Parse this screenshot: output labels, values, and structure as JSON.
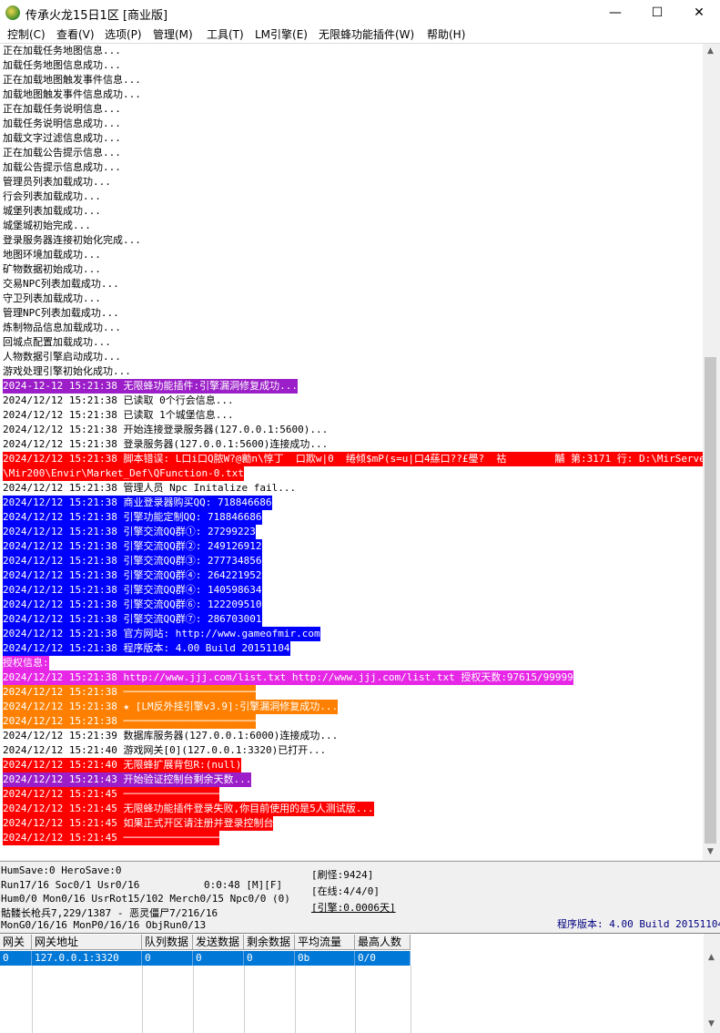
{
  "window": {
    "title": "传承火龙15日1区 [商业版]",
    "minimize": "—",
    "maximize": "☐",
    "close": "✕"
  },
  "menu": [
    "控制(C)",
    "查看(V)",
    "选项(P)",
    "管理(M)",
    "工具(T)",
    "LM引擎(E)",
    "无限蜂功能插件(W)",
    "帮助(H)"
  ],
  "log": [
    {
      "text": "正在加载任务地图信息...",
      "bg": "",
      "color": "#000000"
    },
    {
      "text": "加载任务地图信息成功...",
      "bg": "",
      "color": "#000000"
    },
    {
      "text": "正在加载地图触发事件信息...",
      "bg": "",
      "color": "#000000"
    },
    {
      "text": "加载地图触发事件信息成功...",
      "bg": "",
      "color": "#000000"
    },
    {
      "text": "正在加载任务说明信息...",
      "bg": "",
      "color": "#000000"
    },
    {
      "text": "加载任务说明信息成功...",
      "bg": "",
      "color": "#000000"
    },
    {
      "text": "加载文字过滤信息成功...",
      "bg": "",
      "color": "#000000"
    },
    {
      "text": "正在加载公告提示信息...",
      "bg": "",
      "color": "#000000"
    },
    {
      "text": "加载公告提示信息成功...",
      "bg": "",
      "color": "#000000"
    },
    {
      "text": "管理员列表加载成功...",
      "bg": "",
      "color": "#000000"
    },
    {
      "text": "行会列表加载成功...",
      "bg": "",
      "color": "#000000"
    },
    {
      "text": "城堡列表加载成功...",
      "bg": "",
      "color": "#000000"
    },
    {
      "text": "城堡城初始完成...",
      "bg": "",
      "color": "#000000"
    },
    {
      "text": "登录服务器连接初始化完成...",
      "bg": "",
      "color": "#000000"
    },
    {
      "text": "地图环境加载成功...",
      "bg": "",
      "color": "#000000"
    },
    {
      "text": "矿物数据初始成功...",
      "bg": "",
      "color": "#000000"
    },
    {
      "text": "交易NPC列表加载成功...",
      "bg": "",
      "color": "#000000"
    },
    {
      "text": "守卫列表加载成功...",
      "bg": "",
      "color": "#000000"
    },
    {
      "text": "管理NPC列表加载成功...",
      "bg": "",
      "color": "#000000"
    },
    {
      "text": "炼制物品信息加载成功...",
      "bg": "",
      "color": "#000000"
    },
    {
      "text": "回城点配置加载成功...",
      "bg": "",
      "color": "#000000"
    },
    {
      "text": "人物数据引擎启动成功...",
      "bg": "",
      "color": "#000000"
    },
    {
      "text": "游戏处理引擎初始化成功...",
      "bg": "",
      "color": "#000000"
    },
    {
      "text": "2024-12-12 15:21:38 无限蜂功能插件:引擎漏洞修复成功...",
      "bg": "#9b1ec8",
      "color": "#ffffff"
    },
    {
      "text": "2024/12/12 15:21:38 已读取 0个行会信息...",
      "bg": "",
      "color": "#000000"
    },
    {
      "text": "2024/12/12 15:21:38 已读取 1个城堡信息...",
      "bg": "",
      "color": "#000000"
    },
    {
      "text": "2024/12/12 15:21:38 开始连接登录服务器(127.0.0.1:5600)...",
      "bg": "",
      "color": "#000000"
    },
    {
      "text": "2024/12/12 15:21:38 登录服务器(127.0.0.1:5600)连接成功...",
      "bg": "",
      "color": "#000000"
    },
    {
      "text": "2024/12/12 15:21:38 脚本错误: L口i口Q脓W?@勷n\\惇丁  口欺w|0  绻倾$mP(s=u|口4蕬口??£璺?  祜        黼 第:3171 行: D:\\MirServer",
      "bg": "#ff0000",
      "color": "#ffffff"
    },
    {
      "text": "\\Mir200\\Envir\\Market_Def\\QFunction-0.txt",
      "bg": "#ff0000",
      "color": "#ffffff"
    },
    {
      "text": "2024/12/12 15:21:38 管理人员 Npc Initalize fail...",
      "bg": "",
      "color": "#000000"
    },
    {
      "text": "2024/12/12 15:21:38 商业登录器购买QQ: 718846686",
      "bg": "#0000ff",
      "color": "#ffffff"
    },
    {
      "text": "2024/12/12 15:21:38 引擎功能定制QQ: 718846686",
      "bg": "#0000ff",
      "color": "#ffffff"
    },
    {
      "text": "2024/12/12 15:21:38 引擎交流QQ群①: 27299223",
      "bg": "#0000ff",
      "color": "#ffffff"
    },
    {
      "text": "2024/12/12 15:21:38 引擎交流QQ群②: 249126912",
      "bg": "#0000ff",
      "color": "#ffffff"
    },
    {
      "text": "2024/12/12 15:21:38 引擎交流QQ群③: 277734856",
      "bg": "#0000ff",
      "color": "#ffffff"
    },
    {
      "text": "2024/12/12 15:21:38 引擎交流QQ群④: 264221952",
      "bg": "#0000ff",
      "color": "#ffffff"
    },
    {
      "text": "2024/12/12 15:21:38 引擎交流QQ群④: 140598634",
      "bg": "#0000ff",
      "color": "#ffffff"
    },
    {
      "text": "2024/12/12 15:21:38 引擎交流QQ群⑥: 122209510",
      "bg": "#0000ff",
      "color": "#ffffff"
    },
    {
      "text": "2024/12/12 15:21:38 引擎交流QQ群⑦: 286703001",
      "bg": "#0000ff",
      "color": "#ffffff"
    },
    {
      "text": "2024/12/12 15:21:38 官方网站: http://www.gameofmir.com",
      "bg": "#0000ff",
      "color": "#ffffff"
    },
    {
      "text": "2024/12/12 15:21:38 程序版本: 4.00 Build 20151104",
      "bg": "#0000ff",
      "color": "#ffffff"
    },
    {
      "text": "授权信息:",
      "bg": "#e628e6",
      "color": "#ffffff"
    },
    {
      "text": "2024/12/12 15:21:38 http://www.jjj.com/list.txt http://www.jjj.com/list.txt 授权天数:97615/99999",
      "bg": "#e628e6",
      "color": "#ffffff"
    },
    {
      "text": "2024/12/12 15:21:38 ──────────────────────",
      "bg": "#ff8000",
      "color": "#ffffff"
    },
    {
      "text": "2024/12/12 15:21:38 ★ [LM反外挂引擎v3.9]:引擎漏洞修复成功...",
      "bg": "#ff8000",
      "color": "#ffffff"
    },
    {
      "text": "2024/12/12 15:21:38 ──────────────────────",
      "bg": "#ff8000",
      "color": "#ffffff"
    },
    {
      "text": "2024/12/12 15:21:39 数据库服务器(127.0.0.1:6000)连接成功...",
      "bg": "",
      "color": "#000000"
    },
    {
      "text": "2024/12/12 15:21:40 游戏网关[0](127.0.0.1:3320)已打开...",
      "bg": "",
      "color": "#000000"
    },
    {
      "text": "2024/12/12 15:21:40 无限蜂扩展背包R:(null)",
      "bg": "#ff0000",
      "color": "#ffffff"
    },
    {
      "text": "2024/12/12 15:21:43 开始验证控制台剩余天数...",
      "bg": "#9b1ec8",
      "color": "#ffffff"
    },
    {
      "text": "2024/12/12 15:21:45 ────────────────",
      "bg": "#ff0000",
      "color": "#ffffff"
    },
    {
      "text": "2024/12/12 15:21:45 无限蜂功能插件登录失败,你目前使用的是5人测试版...",
      "bg": "#ff0000",
      "color": "#ffffff"
    },
    {
      "text": "2024/12/12 15:21:45 如果正式开区请注册并登录控制台",
      "bg": "#ff0000",
      "color": "#ffffff"
    },
    {
      "text": "2024/12/12 15:21:45 ────────────────",
      "bg": "#ff0000",
      "color": "#ffffff"
    }
  ],
  "status": {
    "line1": "HumSave:0 HeroSave:0",
    "line2": "Run17/16 Soc0/1 Usr0/16",
    "line2_time": "0:0:48 [M][F]",
    "line3": "Hum0/0 Mon0/16 UsrRot15/102 Merch0/15 Npc0/0 (0)",
    "line4": "骷髅长枪兵7,229/1387 - 恶灵僵尸7/216/16",
    "line5": "MonG0/16/16 MonP0/16/16 ObjRun0/13",
    "refresh": "[刷怪:9424]",
    "online": "[在线:4/4/0]",
    "engine": "[引擎:0.0006天]",
    "version": "程序版本: 4.00 Build 20151104",
    "version_color": "#000080"
  },
  "gateway_table": {
    "headers": [
      "网关",
      "网关地址",
      "队列数据",
      "发送数据",
      "剩余数据",
      "平均流量",
      "最高人数"
    ],
    "rows": [
      [
        "0",
        "127.0.0.1:3320",
        "0",
        "0",
        "0",
        "0b",
        "0/0"
      ]
    ]
  }
}
